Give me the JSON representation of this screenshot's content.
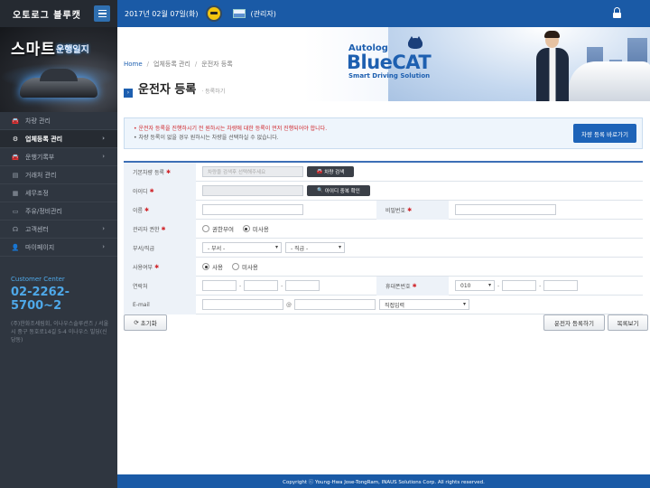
{
  "app": {
    "title": "오토로그 블루캣"
  },
  "topbar": {
    "date": "2017년 02월 07일(화)",
    "user_role": "(관리자)"
  },
  "sidebar": {
    "banner_title": "스마트",
    "banner_subtitle": "운행일지",
    "items": [
      {
        "label": "차량 관리",
        "icon": "car-icon"
      },
      {
        "label": "업체등록 관리",
        "icon": "gear-icon",
        "active": true,
        "chevron": "›"
      },
      {
        "label": "운행기록부",
        "icon": "car-icon",
        "chevron": "›"
      },
      {
        "label": "거래처 관리",
        "icon": "document-icon"
      },
      {
        "label": "세무조정",
        "icon": "calculator-icon"
      },
      {
        "label": "주유/정비관리",
        "icon": "card-icon"
      },
      {
        "label": "고객센터",
        "icon": "headset-icon",
        "chevron": "›"
      },
      {
        "label": "마이페이지",
        "icon": "user-icon",
        "chevron": "›"
      }
    ],
    "customer_center": {
      "label": "Customer Center",
      "phone": "02-2262-5700~2",
      "address": "(주)한화조세림회, 이나우스솔루션즈 / 서울시 중구 동호로14길 5-4 이나우스 빌딩(신당동)"
    }
  },
  "hero": {
    "logo_line1": "Autolog",
    "logo_line2": "BlueCAT",
    "logo_line3": "Smart Driving Solution"
  },
  "breadcrumb": {
    "home": "Home",
    "level1": "업체등록 관리",
    "level2": "운전자 등록"
  },
  "page": {
    "title": "운전자 등록",
    "subtitle": "· 등록하기"
  },
  "notice": {
    "line1": "운전자 등록을 진행하시기 전 원하시는 차량에 대한 등록이 먼저 진행되어야 합니다.",
    "line2": "차량 등록이 없을 경우 원하시는 차량을 선택하실 수 없습니다.",
    "button": "차량 등록 바로가기"
  },
  "form": {
    "vehicle": {
      "label": "기본차량 등록",
      "placeholder": "차량을 검색후 선택해주세요",
      "button": "차량 검색"
    },
    "userid": {
      "label": "아이디",
      "button": "아이디 중복 확인"
    },
    "name": {
      "label": "이름"
    },
    "password": {
      "label": "비밀번호"
    },
    "auth": {
      "label": "관리자 권한",
      "option1": "권한부여",
      "option2": "미사용"
    },
    "dept": {
      "label": "부서/직급",
      "dept_value": "- 부서 -",
      "rank_value": "- 직급 -"
    },
    "use": {
      "label": "사용여부",
      "option1": "사용",
      "option2": "미사용"
    },
    "phone": {
      "label": "연락처"
    },
    "mobile": {
      "label": "휴대폰번호",
      "prefix": "010"
    },
    "email": {
      "label": "E-mail",
      "at": "@",
      "domain_value": "직접입력"
    }
  },
  "buttons": {
    "reset": "초기화",
    "register": "운전자 등록하기",
    "list": "목록보기"
  },
  "footer": {
    "text": "Copyright ⓒ Young-Hwa Jose-TongRam, INAUS Solutions Corp. All rights reserved."
  }
}
